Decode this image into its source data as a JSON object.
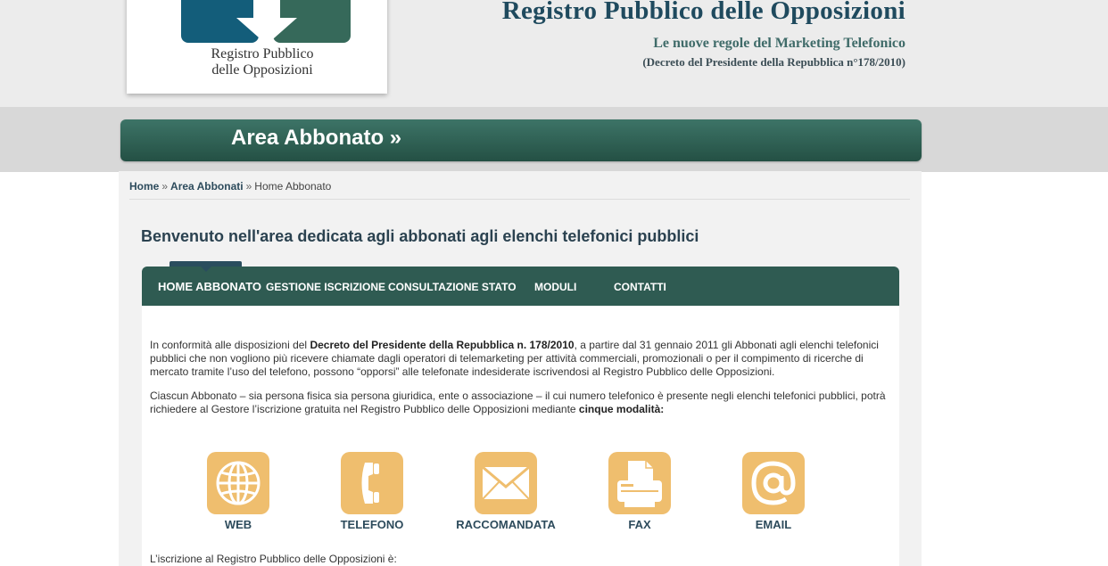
{
  "header": {
    "logo_line1": "Registro Pubblico",
    "logo_line2": "delle Opposizioni",
    "title": "Registro Pubblico delle Opposizioni",
    "subtitle": "Le nuove regole del Marketing Telefonico",
    "decree": "(Decreto del Presidente della Repubblica n°178/2010)"
  },
  "banner": {
    "label": "Area Abbonato »"
  },
  "breadcrumb": {
    "home": "Home",
    "sep1": "»",
    "area": "Area Abbonati",
    "sep2": "»",
    "current": "Home Abbonato"
  },
  "welcome": "Benvenuto nell'area dedicata agli abbonati agli elenchi telefonici pubblici",
  "tabs": [
    {
      "label": "HOME ABBONATO",
      "active": true
    },
    {
      "label": "GESTIONE ISCRIZIONE",
      "active": false
    },
    {
      "label": "CONSULTAZIONE STATO",
      "active": false
    },
    {
      "label": "MODULI",
      "active": false
    },
    {
      "label": "CONTATTI",
      "active": false
    }
  ],
  "paragraph1": {
    "pre": "In conformità alle disposizioni del ",
    "bold": "Decreto del Presidente della Repubblica n. 178/2010",
    "post": ", a partire dal 31 gennaio 2011 gli Abbonati agli elenchi telefonici pubblici che non vogliono più ricevere chiamate dagli operatori di telemarketing per attività commerciali, promozionali o per il compimento di ricerche di mercato tramite l’uso del telefono, possono “opporsi” alle telefonate indesiderate iscrivendosi al Registro Pubblico delle Opposizioni."
  },
  "paragraph2": {
    "pre": "Ciascun Abbonato – sia persona fisica sia persona giuridica, ente o associazione – il cui numero telefonico è presente negli elenchi telefonici pubblici, potrà richiedere al Gestore l’iscrizione gratuita nel Registro Pubblico delle Opposizioni mediante ",
    "bold": "cinque modalità:"
  },
  "modalities": [
    {
      "label": "WEB",
      "icon": "globe-icon"
    },
    {
      "label": "TELEFONO",
      "icon": "phone-icon"
    },
    {
      "label": "RACCOMANDATA",
      "icon": "envelope-icon"
    },
    {
      "label": "FAX",
      "icon": "fax-icon"
    },
    {
      "label": "EMAIL",
      "icon": "at-sign-icon"
    }
  ],
  "footer_text": "L’iscrizione al Registro Pubblico delle Opposizioni è:",
  "colors": {
    "brand_green": "#2f5b52",
    "tile_orange": "#efbe6e",
    "title_blue": "#1f4a5e"
  }
}
